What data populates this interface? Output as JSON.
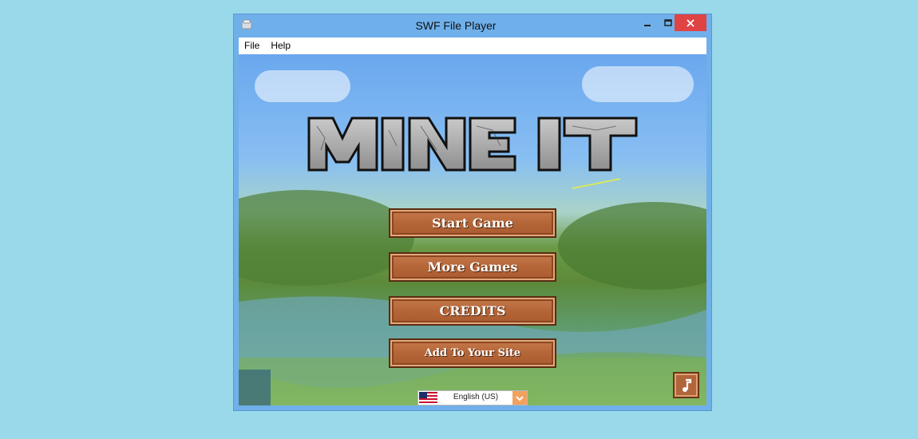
{
  "window": {
    "title": "SWF File Player"
  },
  "menubar": {
    "items": [
      {
        "label": "File"
      },
      {
        "label": "Help"
      }
    ]
  },
  "game": {
    "logo_text": "MINE IT",
    "buttons": {
      "start": "Start Game",
      "more": "More Games",
      "credits": "CREDITS",
      "site": "Add To Your Site"
    },
    "language": {
      "selected": "English (US)",
      "flag_icon": "us-flag-icon"
    },
    "music_icon": "music-note-icon"
  },
  "colors": {
    "desktop": "#99d9ea",
    "titlebar": "#6fb0ea",
    "close": "#e04343",
    "button_wood": "#b56638"
  }
}
